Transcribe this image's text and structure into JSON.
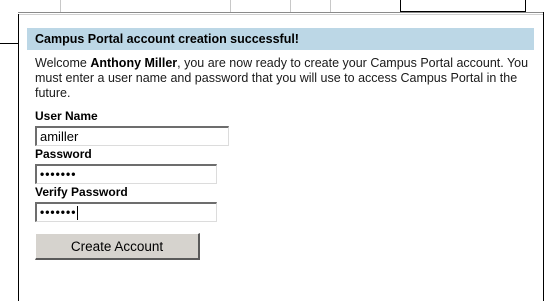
{
  "colors": {
    "banner_bg": "#bcd7e6",
    "button_bg": "#d6d3ce"
  },
  "banner": {
    "title": "Campus Portal account creation successful!"
  },
  "welcome": {
    "prefix": "Welcome ",
    "user_name": "Anthony Miller",
    "suffix": ", you are now ready to create your Campus Portal account. You must enter a user name and password that you will use to access Campus Portal in the future."
  },
  "form": {
    "username": {
      "label": "User Name",
      "value": "amiller"
    },
    "password": {
      "label": "Password",
      "masked_value": "•••••••"
    },
    "verify_password": {
      "label": "Verify Password",
      "masked_value": "•••••••"
    },
    "submit_label": "Create Account"
  }
}
